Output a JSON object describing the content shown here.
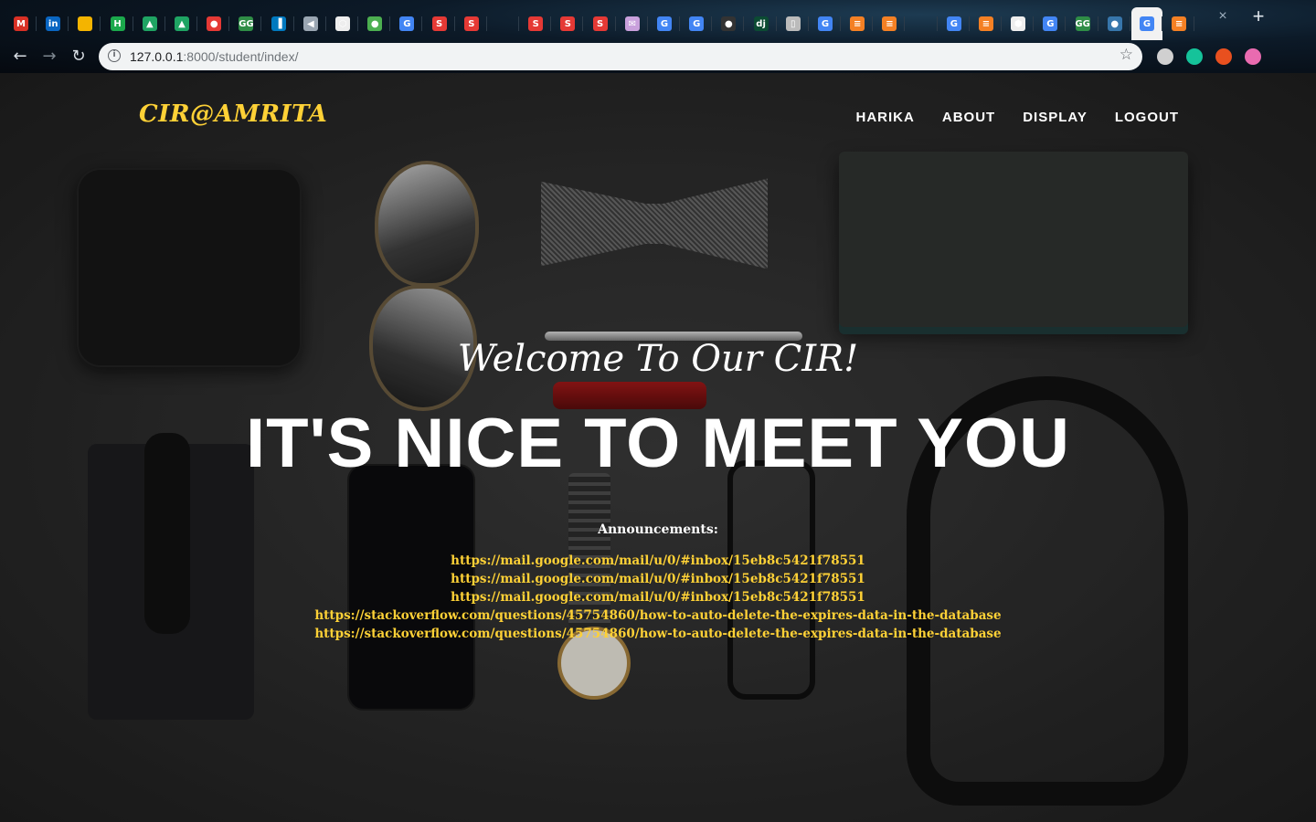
{
  "browser": {
    "tabs": [
      {
        "icon": "gmail-icon",
        "glyph": "M",
        "color": "#d93025"
      },
      {
        "icon": "linkedin-icon",
        "glyph": "in",
        "color": "#0a66c2"
      },
      {
        "icon": "slides-icon",
        "glyph": "",
        "color": "#f4b400"
      },
      {
        "icon": "hackerrank-icon",
        "glyph": "H",
        "color": "#1ba94c"
      },
      {
        "icon": "drive-icon",
        "glyph": "▲",
        "color": "#1fa463"
      },
      {
        "icon": "drive-icon",
        "glyph": "▲",
        "color": "#1fa463"
      },
      {
        "icon": "pokeball-icon",
        "glyph": "●",
        "color": "#e53935"
      },
      {
        "icon": "geeksforgeeks-icon",
        "glyph": "GG",
        "color": "#2f8d46"
      },
      {
        "icon": "trello-icon",
        "glyph": "▐",
        "color": "#0079bf"
      },
      {
        "icon": "audio-icon",
        "glyph": "◀",
        "color": "#9aa6b2"
      },
      {
        "icon": "hexagon-icon",
        "glyph": "⬡",
        "color": "#eeeeee"
      },
      {
        "icon": "leaf-icon",
        "glyph": "●",
        "color": "#4caf50"
      },
      {
        "icon": "google-icon",
        "glyph": "G",
        "color": "#4285f4"
      },
      {
        "icon": "s-icon",
        "glyph": "S",
        "color": "#e53935"
      },
      {
        "icon": "s-icon",
        "glyph": "S",
        "color": "#e53935"
      },
      {
        "icon": "blank-icon",
        "glyph": "",
        "color": "transparent"
      },
      {
        "icon": "s-icon",
        "glyph": "S",
        "color": "#e53935"
      },
      {
        "icon": "s-icon",
        "glyph": "S",
        "color": "#e53935"
      },
      {
        "icon": "s-icon",
        "glyph": "S",
        "color": "#e53935"
      },
      {
        "icon": "envelope-icon",
        "glyph": "✉",
        "color": "#c9a0dc"
      },
      {
        "icon": "google-icon",
        "glyph": "G",
        "color": "#4285f4"
      },
      {
        "icon": "google-icon",
        "glyph": "G",
        "color": "#4285f4"
      },
      {
        "icon": "github-icon",
        "glyph": "●",
        "color": "#333333"
      },
      {
        "icon": "django-icon",
        "glyph": "dj",
        "color": "#0c4b33"
      },
      {
        "icon": "file-icon",
        "glyph": "▯",
        "color": "#bbbbbb"
      },
      {
        "icon": "google-icon",
        "glyph": "G",
        "color": "#4285f4"
      },
      {
        "icon": "stackoverflow-icon",
        "glyph": "≡",
        "color": "#f48024"
      },
      {
        "icon": "stackoverflow-icon",
        "glyph": "≡",
        "color": "#f48024"
      },
      {
        "icon": "blank-icon",
        "glyph": "",
        "color": "transparent"
      },
      {
        "icon": "google-icon",
        "glyph": "G",
        "color": "#4285f4"
      },
      {
        "icon": "stackoverflow-icon",
        "glyph": "≡",
        "color": "#f48024"
      },
      {
        "icon": "cube-icon",
        "glyph": "⬢",
        "color": "#eeeeee"
      },
      {
        "icon": "google-icon",
        "glyph": "G",
        "color": "#4285f4"
      },
      {
        "icon": "geeksforgeeks-icon",
        "glyph": "GG",
        "color": "#2f8d46"
      },
      {
        "icon": "python-icon",
        "glyph": "●",
        "color": "#3776ab"
      },
      {
        "icon": "google-icon",
        "glyph": "G",
        "color": "#4285f4",
        "active": true
      },
      {
        "icon": "stackoverflow-icon",
        "glyph": "≡",
        "color": "#f48024"
      }
    ],
    "close_glyph": "×",
    "new_tab_glyph": "+",
    "url_host": "127.0.0.1",
    "url_rest": ":8000/student/index/",
    "extensions": [
      {
        "icon": "extension-grey-icon",
        "color": "#d0d0d0"
      },
      {
        "icon": "grammarly-icon",
        "color": "#15c39a"
      },
      {
        "icon": "extension-red-icon",
        "color": "#e8501f"
      },
      {
        "icon": "lotus-icon",
        "color": "#e96bb0"
      }
    ]
  },
  "navbar": {
    "brand": "CIR@AMRITA",
    "links": [
      "HARIKA",
      "ABOUT",
      "DISPLAY",
      "LOGOUT"
    ]
  },
  "hero": {
    "lead": "Welcome To Our CIR!",
    "heading": "IT'S NICE TO MEET YOU",
    "announcements_title": "Announcements:",
    "announcements": [
      "https://mail.google.com/mail/u/0/#inbox/15eb8c5421f78551",
      "https://mail.google.com/mail/u/0/#inbox/15eb8c5421f78551",
      "https://mail.google.com/mail/u/0/#inbox/15eb8c5421f78551",
      "https://stackoverflow.com/questions/45754860/how-to-auto-delete-the-expires-data-in-the-database",
      "https://stackoverflow.com/questions/45754860/how-to-auto-delete-the-expires-data-in-the-database"
    ]
  },
  "colors": {
    "accent": "#fed136"
  }
}
